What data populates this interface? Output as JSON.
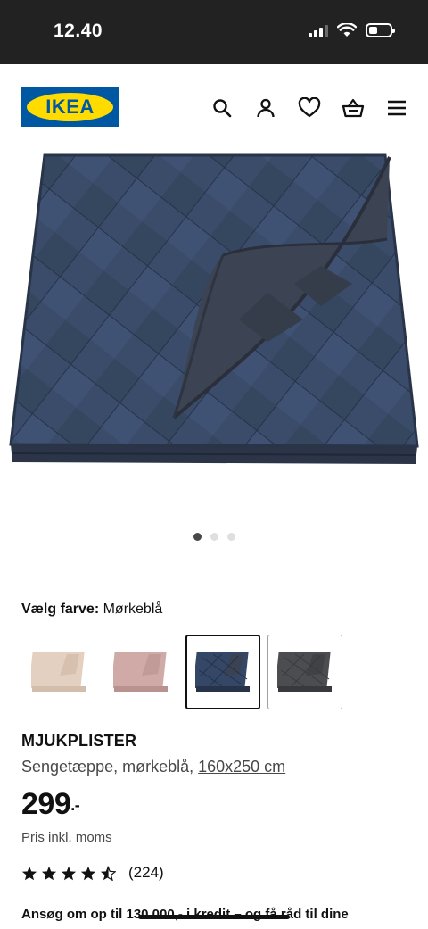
{
  "status_bar": {
    "time": "12.40"
  },
  "header": {
    "logo_text": "IKEA",
    "icons": [
      "search-icon",
      "user-icon",
      "heart-icon",
      "basket-icon",
      "menu-icon"
    ]
  },
  "product": {
    "image_colors": {
      "top": "#3b4d6b",
      "lining": "#3c4352",
      "edge": "#2b3547"
    },
    "carousel_dots": 3,
    "carousel_active_index": 0,
    "color_label": "Vælg farve:",
    "color_value": "Mørkeblå",
    "swatches": [
      {
        "name": "beige",
        "color": "#e4d0c0"
      },
      {
        "name": "pink",
        "color": "#cfaaa7"
      },
      {
        "name": "dark-blue",
        "color": "#344766",
        "selected": true
      },
      {
        "name": "dark-grey",
        "color": "#4b4d50"
      }
    ],
    "name": "MJUKPLISTER",
    "desc_text": "Sengetæppe, mørkeblå, ",
    "desc_size": "160x250 cm",
    "price_main": "299",
    "price_sup": ".-",
    "price_note": "Pris inkl. moms",
    "rating_value": 4.5,
    "rating_count": "(224)",
    "credit_text": "Ansøg om op til 130.000,- i kredit – og få råd til dine"
  }
}
